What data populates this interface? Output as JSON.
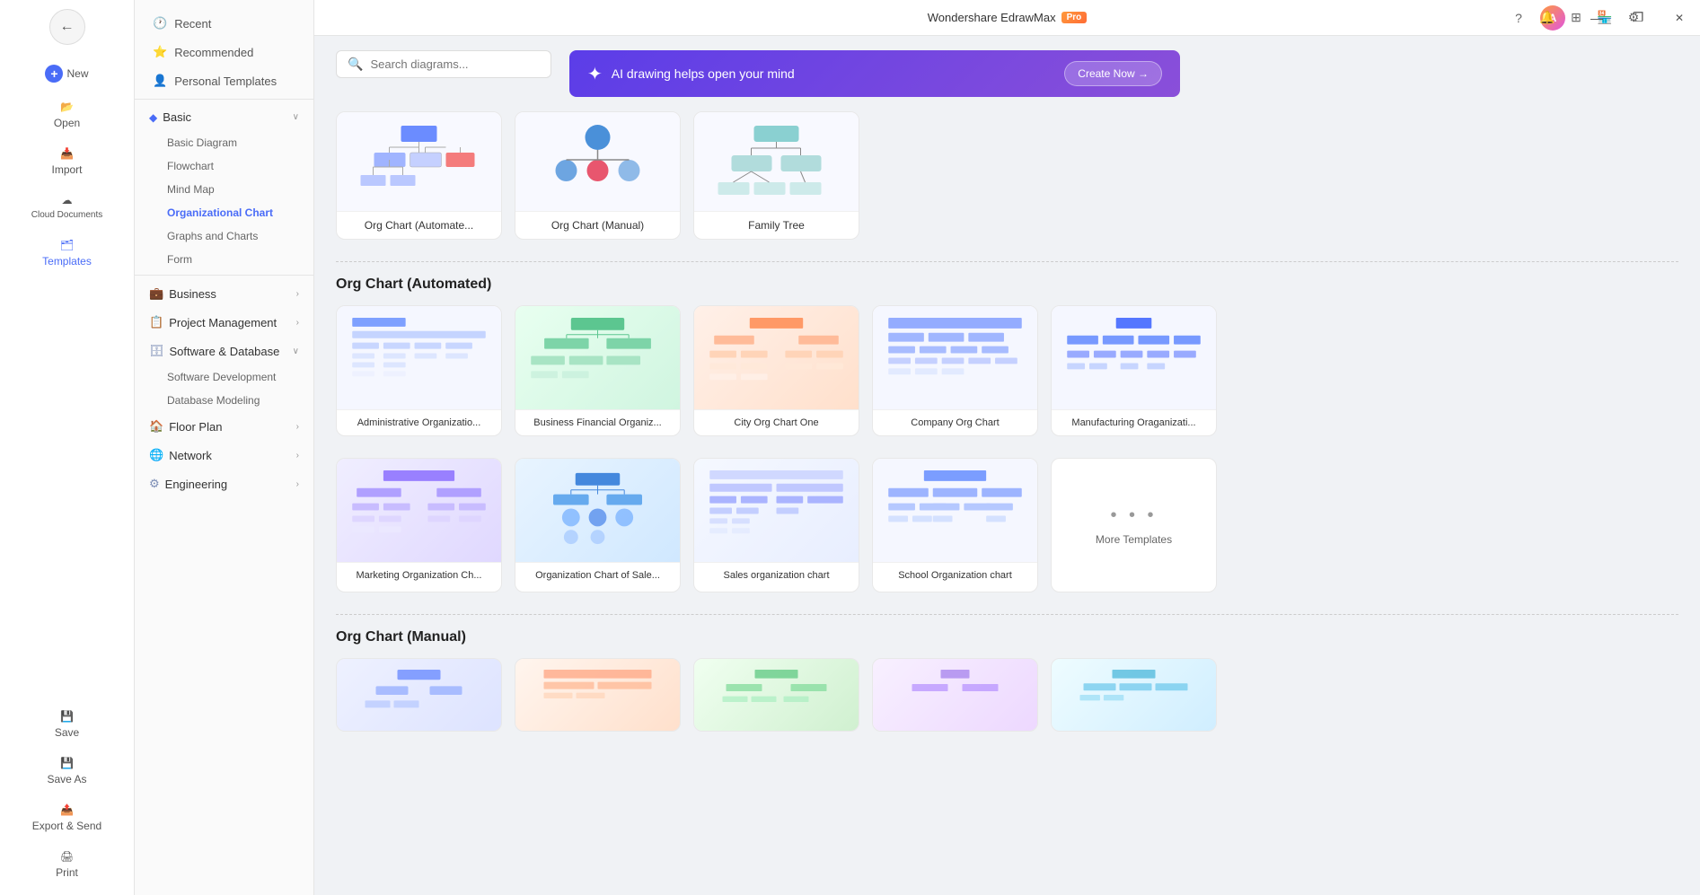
{
  "app": {
    "title": "Wondershare EdrawMax",
    "pro_label": "Pro",
    "window_controls": [
      "—",
      "❐",
      "✕"
    ]
  },
  "sidebar_left": {
    "back_label": "←",
    "items": [
      {
        "id": "new",
        "icon": "＋",
        "label": "New",
        "plus": "+"
      },
      {
        "id": "open",
        "icon": "📂",
        "label": "Open"
      },
      {
        "id": "import",
        "icon": "📥",
        "label": "Import"
      },
      {
        "id": "cloud",
        "icon": "☁",
        "label": "Cloud Documents"
      },
      {
        "id": "templates",
        "icon": "🗂",
        "label": "Templates"
      },
      {
        "id": "save",
        "icon": "💾",
        "label": "Save"
      },
      {
        "id": "save-as",
        "icon": "💾",
        "label": "Save As"
      },
      {
        "id": "export",
        "icon": "📤",
        "label": "Export & Send"
      },
      {
        "id": "print",
        "icon": "🖨",
        "label": "Print"
      }
    ]
  },
  "sidebar_second": {
    "top_items": [
      {
        "id": "recent",
        "icon": "🕐",
        "label": "Recent"
      },
      {
        "id": "recommended",
        "icon": "⭐",
        "label": "Recommended"
      },
      {
        "id": "personal",
        "icon": "👤",
        "label": "Personal Templates"
      }
    ],
    "categories": [
      {
        "id": "basic",
        "label": "Basic",
        "icon": "◆",
        "expanded": true,
        "sub_items": [
          {
            "id": "basic-diagram",
            "label": "Basic Diagram"
          },
          {
            "id": "flowchart",
            "label": "Flowchart"
          },
          {
            "id": "mind-map",
            "label": "Mind Map"
          },
          {
            "id": "org-chart",
            "label": "Organizational Chart",
            "active": true
          }
        ]
      },
      {
        "id": "graphs",
        "label": "Graphs and Charts",
        "indent": true
      },
      {
        "id": "form",
        "label": "Form",
        "indent": true
      },
      {
        "id": "business",
        "label": "Business",
        "icon": "💼",
        "has_arrow": true
      },
      {
        "id": "project-management",
        "label": "Project Management",
        "icon": "📋",
        "has_arrow": true
      },
      {
        "id": "software-database",
        "label": "Software & Database",
        "icon": "🗄",
        "expanded": true,
        "sub_items": [
          {
            "id": "software-dev",
            "label": "Software Development"
          },
          {
            "id": "database-modeling",
            "label": "Database Modeling"
          }
        ]
      },
      {
        "id": "floor-plan",
        "label": "Floor Plan",
        "icon": "🏠",
        "has_arrow": true
      },
      {
        "id": "network",
        "label": "Network",
        "icon": "🌐",
        "has_arrow": true
      },
      {
        "id": "engineering",
        "label": "Engineering",
        "icon": "⚙",
        "has_arrow": true
      }
    ]
  },
  "search": {
    "placeholder": "Search diagrams..."
  },
  "ai_banner": {
    "icon": "✦",
    "text": "AI drawing helps open your mind",
    "cta": "Create Now →"
  },
  "top_cards": [
    {
      "id": "org-auto",
      "label": "Org Chart (Automate..."
    },
    {
      "id": "org-manual",
      "label": "Org Chart (Manual)"
    },
    {
      "id": "family-tree",
      "label": "Family Tree"
    }
  ],
  "section_automated": {
    "title": "Org Chart (Automated)",
    "templates": [
      {
        "id": "admin-org",
        "label": "Administrative Organizatio..."
      },
      {
        "id": "business-financial",
        "label": "Business Financial Organiz..."
      },
      {
        "id": "city-org",
        "label": "City Org Chart One"
      },
      {
        "id": "company-org",
        "label": "Company Org Chart"
      },
      {
        "id": "manufacturing",
        "label": "Manufacturing Oraganizati..."
      },
      {
        "id": "marketing-org",
        "label": "Marketing Organization Ch..."
      },
      {
        "id": "org-sales",
        "label": "Organization Chart of Sale..."
      },
      {
        "id": "sales-org",
        "label": "Sales organization chart"
      },
      {
        "id": "school-org",
        "label": "School Organization chart"
      }
    ]
  },
  "section_manual": {
    "title": "Org Chart (Manual)",
    "templates": [
      {
        "id": "manual-1",
        "label": ""
      },
      {
        "id": "manual-2",
        "label": ""
      },
      {
        "id": "manual-3",
        "label": ""
      },
      {
        "id": "manual-4",
        "label": ""
      },
      {
        "id": "manual-5",
        "label": ""
      }
    ]
  },
  "more_templates": {
    "dots": "• • •",
    "label": "More Templates"
  }
}
